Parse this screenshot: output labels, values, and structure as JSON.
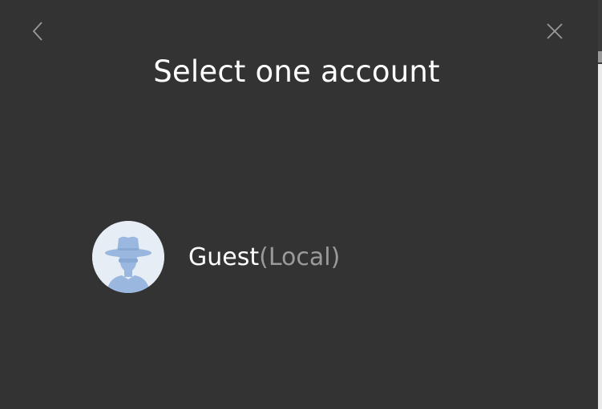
{
  "dialog": {
    "title": "Select one account"
  },
  "accounts": [
    {
      "name": "Guest",
      "type": "(Local)",
      "avatar_icon": "incognito-user-icon"
    }
  ],
  "icons": {
    "back": "chevron-left-icon",
    "close": "close-icon"
  },
  "colors": {
    "background": "#333333",
    "title_text": "#ffffff",
    "secondary_text": "#9a9a9a",
    "icon": "#9a9a9a",
    "avatar_bg": "#e6edf5",
    "avatar_figure": "#9ab8df"
  }
}
